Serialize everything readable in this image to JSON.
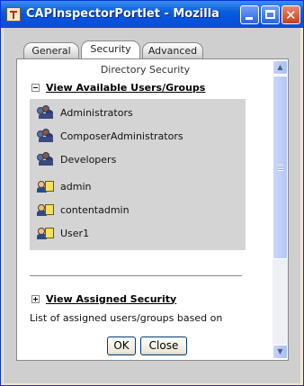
{
  "window": {
    "title": "CAPInspectorPortlet - Mozilla",
    "close_glyph": "✕"
  },
  "tabs": [
    {
      "label": "General"
    },
    {
      "label": "Security",
      "active": true
    },
    {
      "label": "Advanced"
    }
  ],
  "panel": {
    "title": "Directory Security",
    "section_users": {
      "label": "View Available Users/Groups",
      "expanded": true
    },
    "users": [
      {
        "name": "Administrators",
        "type": "group"
      },
      {
        "name": "ComposerAdministrators",
        "type": "group"
      },
      {
        "name": "Developers",
        "type": "group"
      },
      {
        "name": "admin",
        "type": "user"
      },
      {
        "name": "contentadmin",
        "type": "user"
      },
      {
        "name": "User1",
        "type": "user"
      }
    ],
    "section_assigned": {
      "label": "View Assigned Security",
      "expanded": false
    },
    "description": "List of assigned users/groups based on"
  },
  "scrollbar": {
    "up_glyph": "▲",
    "down_glyph": "▼"
  },
  "buttons": {
    "ok": "OK",
    "close": "Close"
  },
  "colors": {
    "title_bar": "#0554e3",
    "content_bg": "#cfcfcf",
    "list_bg": "#d4d4d4"
  }
}
